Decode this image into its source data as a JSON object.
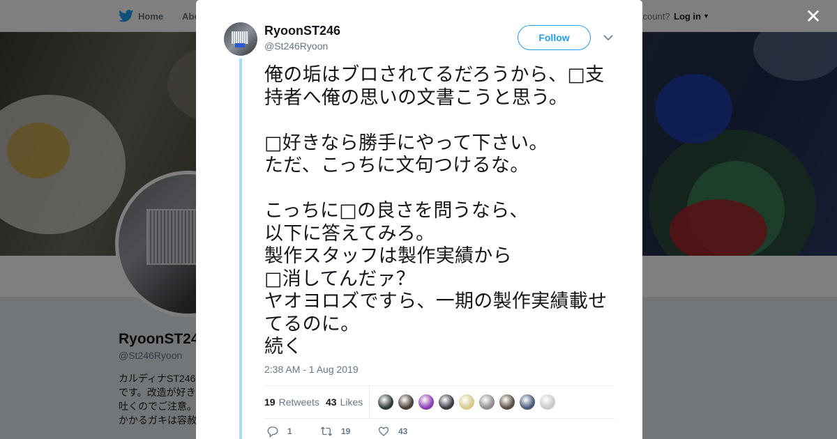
{
  "nav": {
    "home_label": "Home",
    "about_label": "Abo",
    "account_text": "ccount?",
    "login_label": "Log in",
    "brand_color": "#1da1f2"
  },
  "profile": {
    "name": "RyoonST24",
    "handle": "@St246Ryoon",
    "bio": "カルディナST246\nです。改造が好き\n吐くのでご注意。\nかかるガキは容赦"
  },
  "tweet": {
    "author_name": "RyoonST246",
    "author_handle": "@St246Ryoon",
    "follow_label": "Follow",
    "text": "俺の垢はブロされてるだろうから、□支持者へ俺の思いの文書こうと思う。\n\n□好きなら勝手にやって下さい。\nただ、こっちに文句つけるな。\n\nこっちに□の良さを問うなら、\n以下に答えてみろ。\n製作スタッフは製作実績から\n□消してんだァ？\nヤオヨロズですら、一期の製作実績載せてるのに。\n続く",
    "timestamp": "2:38 AM - 1 Aug 2019",
    "retweets_count": "19",
    "retweets_label": "Retweets",
    "likes_count": "43",
    "likes_label": "Likes",
    "likers": [
      {
        "color": "#2e3a34"
      },
      {
        "color": "#4a3f36"
      },
      {
        "color": "#8a3fb0"
      },
      {
        "color": "#3a3d48"
      },
      {
        "color": "#d8c98a"
      },
      {
        "color": "#8d8d8d"
      },
      {
        "color": "#5a5040"
      },
      {
        "color": "#4a5a78"
      },
      {
        "color": "#c9c9c9"
      }
    ],
    "actions": {
      "reply_count": "1",
      "retweet_count": "19",
      "like_count": "43"
    }
  }
}
